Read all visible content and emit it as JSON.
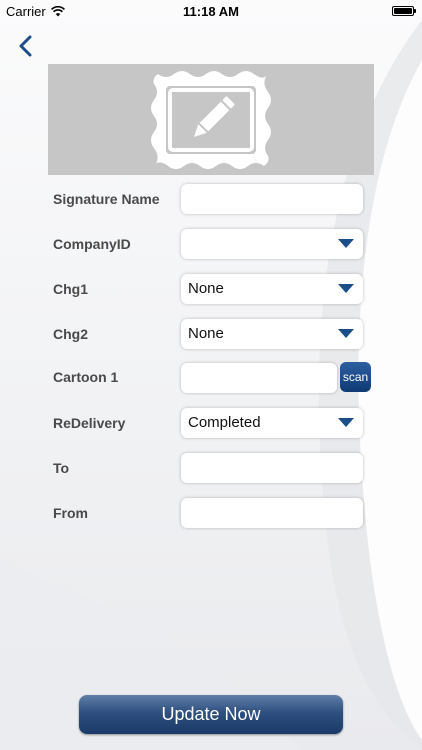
{
  "status_bar": {
    "carrier": "Carrier",
    "time": "11:18 AM"
  },
  "icons": {
    "back": "chevron-left-icon",
    "signature": "framed-pencil-icon",
    "wifi": "wifi-icon",
    "battery": "battery-icon",
    "dropdown": "caret-down-icon"
  },
  "form": {
    "signature_name": {
      "label": "Signature Name",
      "value": ""
    },
    "company_id": {
      "label": "CompanyID",
      "value": ""
    },
    "chg1": {
      "label": "Chg1",
      "value": "None"
    },
    "chg2": {
      "label": "Chg2",
      "value": "None"
    },
    "cartoon1": {
      "label": "Cartoon 1",
      "value": "",
      "scan_label": "scan"
    },
    "redelivery": {
      "label": "ReDelivery",
      "value": "Completed"
    },
    "to": {
      "label": "To",
      "value": ""
    },
    "from": {
      "label": "From",
      "value": ""
    }
  },
  "actions": {
    "update_label": "Update Now"
  },
  "colors": {
    "accent": "#1b4e89",
    "button_dark": "#1a3a68",
    "image_placeholder": "#c6c6c7"
  }
}
